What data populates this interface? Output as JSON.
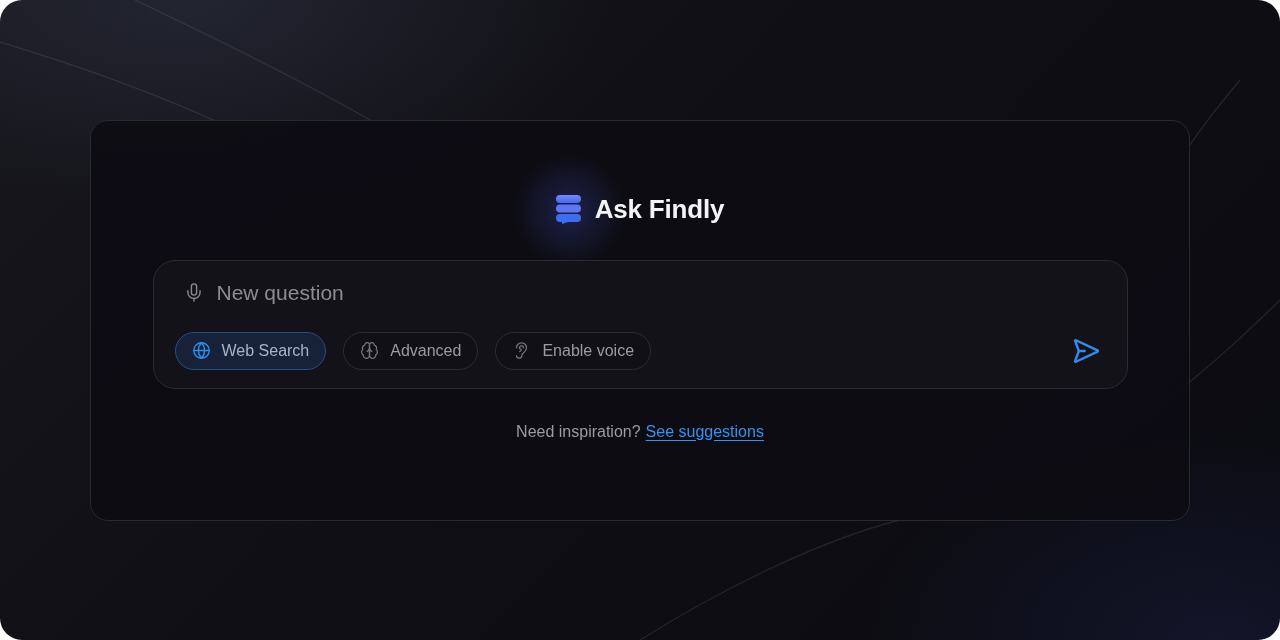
{
  "app": {
    "title": "Ask Findly"
  },
  "composer": {
    "placeholder": "New question",
    "options": [
      {
        "kind": "web",
        "label": "Web Search",
        "selected": true
      },
      {
        "kind": "advanced",
        "label": "Advanced",
        "selected": false
      },
      {
        "kind": "voice",
        "label": "Enable voice",
        "selected": false
      }
    ]
  },
  "footer": {
    "prompt": "Need inspiration?",
    "link": "See suggestions"
  }
}
